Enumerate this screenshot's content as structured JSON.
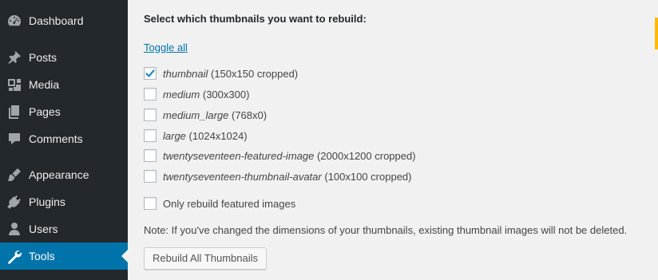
{
  "sidebar": {
    "items": [
      {
        "label": "Dashboard",
        "icon": "dashboard-icon"
      },
      {
        "label": "Posts",
        "icon": "pin-icon"
      },
      {
        "label": "Media",
        "icon": "media-icon"
      },
      {
        "label": "Pages",
        "icon": "pages-icon"
      },
      {
        "label": "Comments",
        "icon": "comment-icon"
      },
      {
        "label": "Appearance",
        "icon": "paintbrush-icon"
      },
      {
        "label": "Plugins",
        "icon": "plug-icon"
      },
      {
        "label": "Users",
        "icon": "user-icon"
      },
      {
        "label": "Tools",
        "icon": "wrench-icon",
        "current": true
      }
    ]
  },
  "main": {
    "heading": "Select which thumbnails you want to rebuild:",
    "toggle_all": "Toggle all",
    "sizes": [
      {
        "name": "thumbnail",
        "dims": "(150x150 cropped)",
        "checked": true
      },
      {
        "name": "medium",
        "dims": "(300x300)",
        "checked": false
      },
      {
        "name": "medium_large",
        "dims": "(768x0)",
        "checked": false
      },
      {
        "name": "large",
        "dims": "(1024x1024)",
        "checked": false
      },
      {
        "name": "twentyseventeen-featured-image",
        "dims": "(2000x1200 cropped)",
        "checked": false
      },
      {
        "name": "twentyseventeen-thumbnail-avatar",
        "dims": "(100x100 cropped)",
        "checked": false
      }
    ],
    "featured_only": {
      "label": "Only rebuild featured images",
      "checked": false
    },
    "note": "Note: If you've changed the dimensions of your thumbnails, existing thumbnail images will not be deleted.",
    "button": "Rebuild All Thumbnails"
  },
  "colors": {
    "sidebar_bg": "#23282d",
    "current_bg": "#0073aa",
    "link": "#0073aa",
    "check": "#1e8cbe",
    "accent": "#ffb900"
  }
}
